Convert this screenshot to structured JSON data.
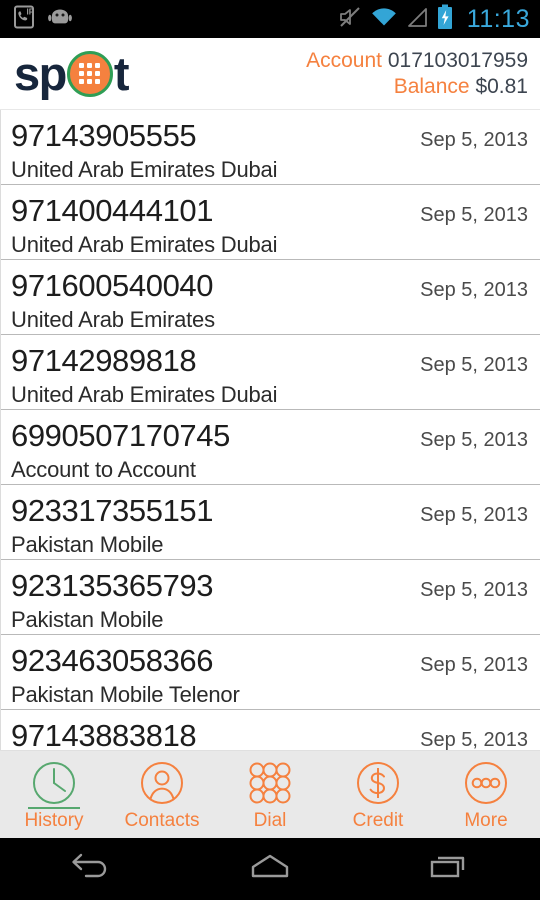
{
  "status_bar": {
    "left_icons": [
      "sip-call-icon",
      "android-robot-icon"
    ],
    "right_icons": [
      "volume-muted-icon",
      "wifi-icon",
      "cellular-signal-icon",
      "battery-charging-icon"
    ],
    "time": "11:13",
    "time_color": "#3aa9dd",
    "background": "#000000"
  },
  "header": {
    "logo_text_before": "sp",
    "logo_text_after": "t",
    "logo_o_fill": "#f5813f",
    "logo_o_ring": "#2f9e55",
    "logo_text_color": "#17263c",
    "account_label": "Account",
    "account_value": "017103017959",
    "balance_label": "Balance",
    "balance_value": "$0.81",
    "label_color": "#f5813f",
    "value_color": "#3d4550"
  },
  "history": {
    "rows": [
      {
        "number": "97143905555",
        "destination": "United Arab Emirates Dubai",
        "date": "Sep 5, 2013"
      },
      {
        "number": "971400444101",
        "destination": "United Arab Emirates Dubai",
        "date": "Sep 5, 2013"
      },
      {
        "number": "971600540040",
        "destination": "United Arab Emirates",
        "date": "Sep 5, 2013"
      },
      {
        "number": "97142989818",
        "destination": "United Arab Emirates Dubai",
        "date": "Sep 5, 2013"
      },
      {
        "number": "6990507170745",
        "destination": "Account to Account",
        "date": "Sep 5, 2013"
      },
      {
        "number": "923317355151",
        "destination": "Pakistan Mobile",
        "date": "Sep 5, 2013"
      },
      {
        "number": "923135365793",
        "destination": "Pakistan Mobile",
        "date": "Sep 5, 2013"
      },
      {
        "number": "923463058366",
        "destination": "Pakistan Mobile Telenor",
        "date": "Sep 5, 2013"
      },
      {
        "number": "97143883818",
        "destination": "",
        "date": "Sep 5, 2013"
      }
    ]
  },
  "tab_bar": {
    "background": "#e9e9e9",
    "active_color": "#57a86f",
    "inactive_color": "#f5813f",
    "tabs": [
      {
        "label": "History",
        "icon": "clock-icon",
        "active": true
      },
      {
        "label": "Contacts",
        "icon": "person-icon",
        "active": false
      },
      {
        "label": "Dial",
        "icon": "dialpad-icon",
        "active": false
      },
      {
        "label": "Credit",
        "icon": "dollar-icon",
        "active": false
      },
      {
        "label": "More",
        "icon": "ellipsis-icon",
        "active": false
      }
    ]
  },
  "nav_bar": {
    "buttons": [
      {
        "name": "back-button",
        "icon": "back-arrow-icon"
      },
      {
        "name": "home-button",
        "icon": "home-icon"
      },
      {
        "name": "recents-button",
        "icon": "recents-icon"
      }
    ]
  }
}
